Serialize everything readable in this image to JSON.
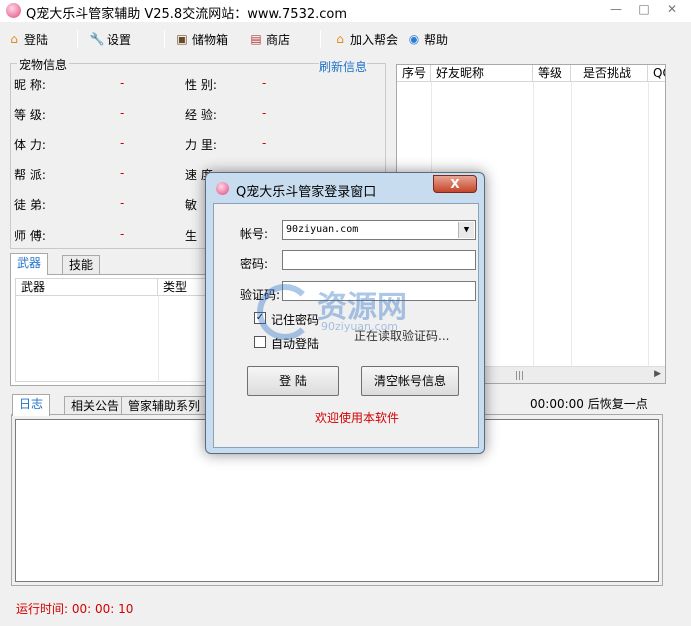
{
  "window": {
    "title": "Q宠大乐斗管家辅助 V25.8交流网站：www.7532.com",
    "min": "—",
    "max": "□",
    "close": "✕"
  },
  "toolbar": {
    "login": "登陆",
    "settings": "设置",
    "storage": "储物箱",
    "shop": "商店",
    "join_guild": "加入帮会",
    "help": "帮助"
  },
  "pet_info": {
    "legend": "宠物信息",
    "refresh": "刷新信息",
    "fields": [
      {
        "label": "昵  称:",
        "value": "-"
      },
      {
        "label": "等  级:",
        "value": "-"
      },
      {
        "label": "体  力:",
        "value": "-"
      },
      {
        "label": "帮  派:",
        "value": "-"
      },
      {
        "label": "徒  弟:",
        "value": "-"
      },
      {
        "label": "师  傅:",
        "value": "-"
      },
      {
        "label": "性  别:",
        "value": "-"
      },
      {
        "label": "经  验:",
        "value": "-"
      },
      {
        "label": "力  里:",
        "value": "-"
      },
      {
        "label": "速  度:",
        "value": "-"
      },
      {
        "label": "敏",
        "value": ""
      },
      {
        "label": "生",
        "value": ""
      }
    ]
  },
  "friend_list": {
    "columns": [
      "序号",
      "好友昵称",
      "等级",
      "是否挑战",
      "QQ"
    ]
  },
  "weapon_tabs": {
    "tabs": [
      "武器",
      "技能"
    ],
    "columns": [
      "武器",
      "类型"
    ]
  },
  "recover_text": "00:00:00 后恢复一点",
  "log_tabs": [
    "日志",
    "相关公告",
    "管家辅助系列"
  ],
  "runtime": "运行时间: 00: 00: 10",
  "dialog": {
    "title": "Q宠大乐斗管家登录窗口",
    "close": "X",
    "account_label": "帐号:",
    "account_value": "90ziyuan.com",
    "password_label": "密码:",
    "captcha_label": "验证码:",
    "remember": "记住密码",
    "auto_login": "自动登陆",
    "reading_captcha": "正在读取验证码...",
    "login_button": "登  陆",
    "clear_button": "清空帐号信息",
    "welcome": "欢迎使用本软件"
  },
  "watermark": {
    "text": "资源网",
    "sub": "90ziyuan.com"
  }
}
